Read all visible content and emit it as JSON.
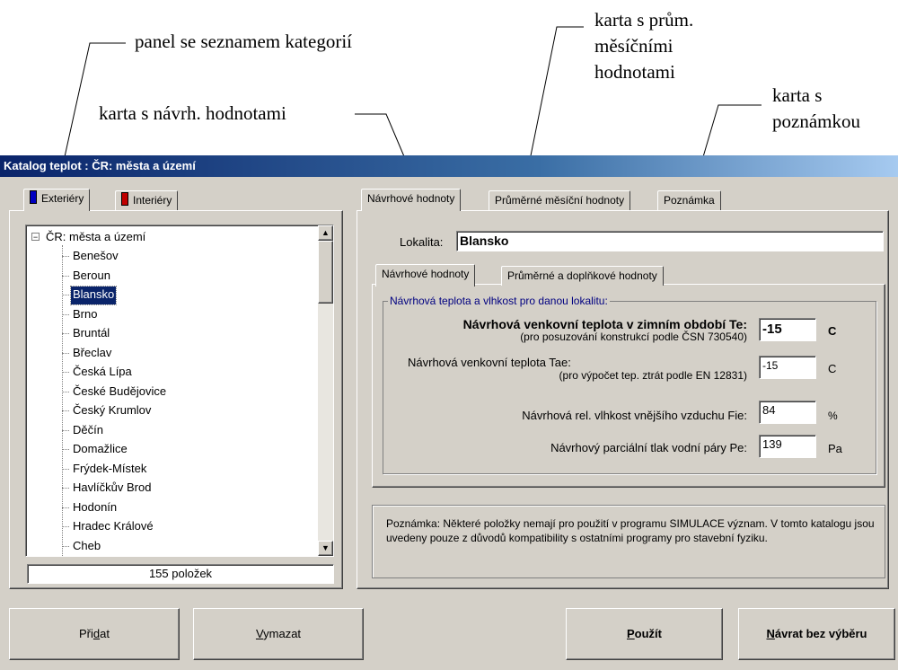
{
  "callouts": {
    "categories_panel": "panel se seznamem kategorií",
    "monthly_tab": [
      "karta s prům.",
      "měsíčními",
      "hodnotami"
    ],
    "design_tab": "karta s návrh. hodnotami",
    "note_tab": [
      "karta s",
      "poznámkou"
    ]
  },
  "window": {
    "title": "Katalog teplot : ČR: města a území"
  },
  "left_tabs": [
    "Exteriéry",
    "Interiéry"
  ],
  "tree": {
    "root": "ČR: města a území",
    "items": [
      "Benešov",
      "Beroun",
      "Blansko",
      "Brno",
      "Bruntál",
      "Břeclav",
      "Česká Lípa",
      "České Budějovice",
      "Český Krumlov",
      "Děčín",
      "Domažlice",
      "Frýdek-Místek",
      "Havlíčkův Brod",
      "Hodonín",
      "Hradec Králové",
      "Cheb"
    ],
    "selected": "Blansko",
    "count": "155 položek"
  },
  "right_tabs": [
    "Návrhové hodnoty",
    "Průměrné měsíční hodnoty",
    "Poznámka"
  ],
  "locality": {
    "label": "Lokalita:",
    "value": "Blansko"
  },
  "inner_tabs": [
    "Návrhové hodnoty",
    "Průměrné a doplňkové hodnoty"
  ],
  "group": {
    "title": "Návrhová teplota a vlhkost pro danou lokalitu:",
    "te_label": "Návrhová venkovní teplota v zimním období Te:",
    "te_sub": "(pro posuzování konstrukcí podle ČSN 730540)",
    "te_value": "-15",
    "te_unit": "C",
    "tae_label": "Návrhová venkovní teplota Tae:",
    "tae_sub": "(pro výpočet tep. ztrát podle EN 12831)",
    "tae_value": "-15",
    "tae_unit": "C",
    "fie_label": "Návrhová rel. vlhkost vnějšího vzduchu Fie:",
    "fie_value": "84",
    "fie_unit": "%",
    "pe_label": "Návrhový parciální tlak vodní páry Pe:",
    "pe_value": "139",
    "pe_unit": "Pa"
  },
  "note": "Poznámka: Některé položky nemají pro použití v programu SIMULACE význam. V tomto katalogu jsou uvedeny pouze z důvodů kompatibility s ostatními programy pro stavební fyziku.",
  "buttons": {
    "add": "Přidat",
    "delete": "Vymazat",
    "use": "Použít",
    "back": "Návrat bez výběru"
  }
}
